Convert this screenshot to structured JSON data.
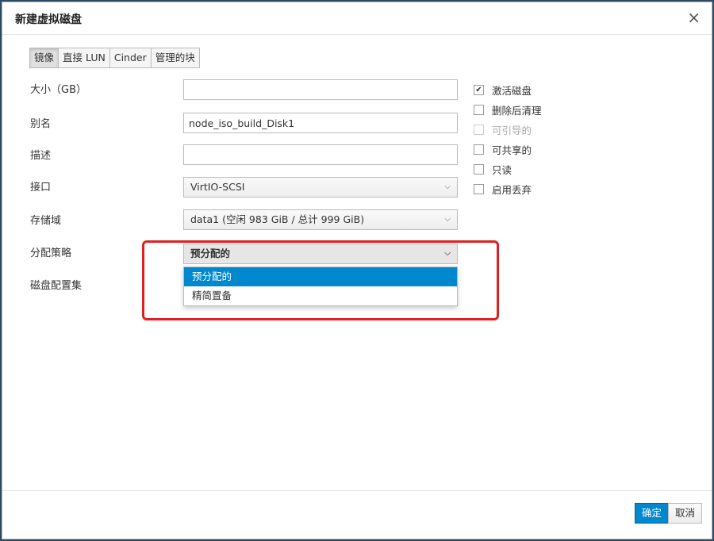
{
  "dialog": {
    "title": "新建虚拟磁盘",
    "close_icon": "×"
  },
  "tabs": [
    {
      "label": "镜像",
      "active": true
    },
    {
      "label": "直接 LUN"
    },
    {
      "label": "Cinder"
    },
    {
      "label": "管理的块"
    }
  ],
  "form": {
    "size_label": "大小（GB）",
    "size_value": "",
    "alias_label": "别名",
    "alias_value": "node_iso_build_Disk1",
    "desc_label": "描述",
    "desc_value": "",
    "interface_label": "接口",
    "interface_value": "VirtIO-SCSI",
    "storage_label": "存储域",
    "storage_value": "data1 (空闲 983 GiB / 总计 999 GiB)",
    "alloc_label": "分配策略",
    "alloc_value": "预分配的",
    "alloc_options": [
      "预分配的",
      "精简置备"
    ],
    "profile_label": "磁盘配置集"
  },
  "checkboxes": [
    {
      "label": "激活磁盘",
      "checked": true,
      "disabled": false
    },
    {
      "label": "删除后清理",
      "checked": false,
      "disabled": false
    },
    {
      "label": "可引导的",
      "checked": false,
      "disabled": true
    },
    {
      "label": "可共享的",
      "checked": false,
      "disabled": false
    },
    {
      "label": "只读",
      "checked": false,
      "disabled": false
    },
    {
      "label": "启用丢弃",
      "checked": false,
      "disabled": false
    }
  ],
  "footer": {
    "ok_label": "确定",
    "cancel_label": "取消"
  },
  "colors": {
    "primary": "#0088ce",
    "highlight": "#e02020"
  }
}
